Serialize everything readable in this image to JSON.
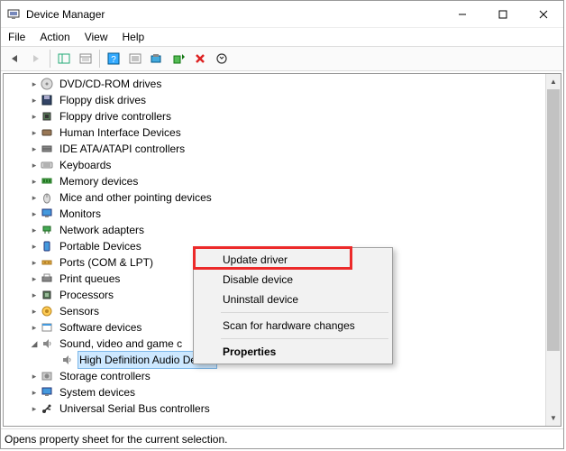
{
  "window": {
    "title": "Device Manager"
  },
  "menu": {
    "file": "File",
    "action": "Action",
    "view": "View",
    "help": "Help"
  },
  "tree": [
    {
      "label": "DVD/CD-ROM drives",
      "icon": "disc"
    },
    {
      "label": "Floppy disk drives",
      "icon": "floppy"
    },
    {
      "label": "Floppy drive controllers",
      "icon": "chip"
    },
    {
      "label": "Human Interface Devices",
      "icon": "hid"
    },
    {
      "label": "IDE ATA/ATAPI controllers",
      "icon": "ide"
    },
    {
      "label": "Keyboards",
      "icon": "keyboard"
    },
    {
      "label": "Memory devices",
      "icon": "memory"
    },
    {
      "label": "Mice and other pointing devices",
      "icon": "mouse"
    },
    {
      "label": "Monitors",
      "icon": "monitor"
    },
    {
      "label": "Network adapters",
      "icon": "network"
    },
    {
      "label": "Portable Devices",
      "icon": "portable"
    },
    {
      "label": "Ports (COM & LPT)",
      "icon": "port"
    },
    {
      "label": "Print queues",
      "icon": "printer"
    },
    {
      "label": "Processors",
      "icon": "cpu"
    },
    {
      "label": "Sensors",
      "icon": "sensor"
    },
    {
      "label": "Software devices",
      "icon": "software"
    },
    {
      "label": "Sound, video and game controllers",
      "icon": "sound",
      "expanded": true,
      "selected_child": "High Definition Audio Device"
    },
    {
      "label": "Storage controllers",
      "icon": "storage"
    },
    {
      "label": "System devices",
      "icon": "system"
    },
    {
      "label": "Universal Serial Bus controllers",
      "icon": "usb"
    }
  ],
  "selected_device": "High Definition Audio Device",
  "context_menu": {
    "update": "Update driver",
    "disable": "Disable device",
    "uninstall": "Uninstall device",
    "scan": "Scan for hardware changes",
    "properties": "Properties"
  },
  "status": "Opens property sheet for the current selection."
}
